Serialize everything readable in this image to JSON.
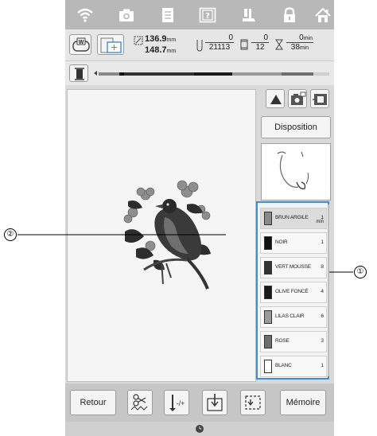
{
  "info": {
    "size_w": "136.9",
    "size_h": "148.7",
    "size_unit": "mm",
    "stitch_cur": "0",
    "stitch_total": "21113",
    "color_cur": "0",
    "color_total": "12",
    "time_cur": "0",
    "time_total": "38",
    "time_unit": "min",
    "frame_label": "W"
  },
  "right_panel": {
    "disposition_label": "Disposition"
  },
  "colors": [
    {
      "name": "BRUN ARGILE",
      "count": "1",
      "unit": "min",
      "swatch": "#8a8a8a",
      "selected": true
    },
    {
      "name": "NOIR",
      "count": "1",
      "swatch": "#111111"
    },
    {
      "name": "VERT MOUSSE",
      "count": "8",
      "swatch": "#333333"
    },
    {
      "name": "OLIVE FONCÉ",
      "count": "4",
      "swatch": "#1a1a1a"
    },
    {
      "name": "LILAS CLAIR",
      "count": "6",
      "swatch": "#9a9a9a"
    },
    {
      "name": "ROSE",
      "count": "3",
      "swatch": "#6e6e6e"
    },
    {
      "name": "BLANC",
      "count": "1",
      "swatch": "#ffffff"
    }
  ],
  "bottom": {
    "back_label": "Retour",
    "memory_label": "Mémoire"
  },
  "callouts": {
    "one": "①",
    "two": "②"
  }
}
